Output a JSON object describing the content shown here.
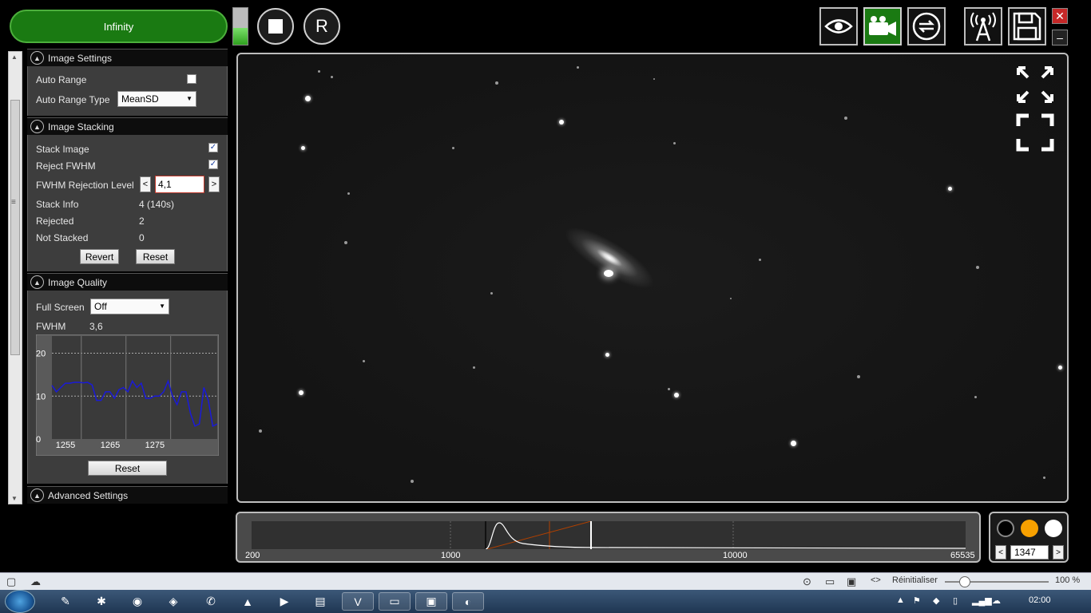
{
  "toolbar": {
    "profile_label": "Infinity",
    "restart_label": "R",
    "level_meter_value": 0.45
  },
  "icons": {
    "stop": "stop-icon",
    "eye": "eye-icon",
    "camera": "video-camera-icon",
    "cycle": "refresh-icon",
    "broadcast": "antenna-icon",
    "save": "save-icon",
    "close": "close-icon",
    "minimize": "minimize-icon"
  },
  "image_settings": {
    "title": "Image Settings",
    "auto_range_label": "Auto Range",
    "auto_range_checked": false,
    "auto_range_type_label": "Auto Range Type",
    "auto_range_type_value": "MeanSD"
  },
  "image_stacking": {
    "title": "Image Stacking",
    "stack_image_label": "Stack Image",
    "stack_image_checked": true,
    "reject_fwhm_label": "Reject FWHM",
    "reject_fwhm_checked": true,
    "fwhm_rejection_label": "FWHM Rejection Level",
    "fwhm_rejection_value": "4,1",
    "decrement": "<",
    "increment": ">",
    "stack_info_label": "Stack Info",
    "stack_info_value": "4 (140s)",
    "rejected_label": "Rejected",
    "rejected_value": "2",
    "not_stacked_label": "Not Stacked",
    "not_stacked_value": "0",
    "revert_label": "Revert",
    "reset_label": "Reset"
  },
  "image_quality": {
    "title": "Image Quality",
    "full_screen_label": "Full Screen",
    "full_screen_value": "Off",
    "fwhm_label": "FWHM",
    "fwhm_value": "3,6",
    "reset_label": "Reset"
  },
  "chart_data": {
    "type": "line",
    "title": "",
    "xlabel": "",
    "ylabel": "",
    "x_ticks": [
      "1255",
      "1265",
      "1275"
    ],
    "y_ticks": [
      "0",
      "10",
      "20"
    ],
    "xlim": [
      1252,
      1289
    ],
    "ylim": [
      0,
      20
    ],
    "grid": true,
    "series": [
      {
        "color": "#1a1ad8",
        "x": [
          1252,
          1253,
          1254,
          1255,
          1256,
          1257,
          1258,
          1259,
          1260,
          1261,
          1262,
          1263,
          1264,
          1265,
          1266,
          1267,
          1268,
          1269,
          1270,
          1271,
          1272,
          1273,
          1274,
          1275,
          1276,
          1277,
          1278,
          1279,
          1280,
          1281,
          1282,
          1283,
          1284,
          1285,
          1286,
          1287,
          1288,
          1289
        ],
        "values": [
          12.5,
          11,
          12,
          13,
          13,
          13.2,
          13.2,
          13.1,
          13.2,
          12.6,
          9,
          9,
          11,
          11,
          9.5,
          11.5,
          12,
          11,
          13.5,
          12,
          13,
          9.5,
          9.5,
          10,
          10,
          11,
          13.5,
          10,
          8,
          11,
          11,
          6,
          3,
          3.5,
          12,
          9,
          3,
          3.5
        ]
      }
    ]
  },
  "advanced_settings": {
    "title": "Advanced Settings"
  },
  "histogram": {
    "labels": [
      "200",
      "1000",
      "10000",
      "65535"
    ]
  },
  "frame_selector": {
    "colors": [
      "#000000",
      "#f7a000",
      "#ffffff"
    ],
    "frame_number": "1347",
    "prev": "<",
    "next": ">"
  },
  "status_bar": {
    "reset_label": "Réinitialiser",
    "zoom_value": "100 %"
  },
  "taskbar": {
    "clock": "02:00"
  }
}
